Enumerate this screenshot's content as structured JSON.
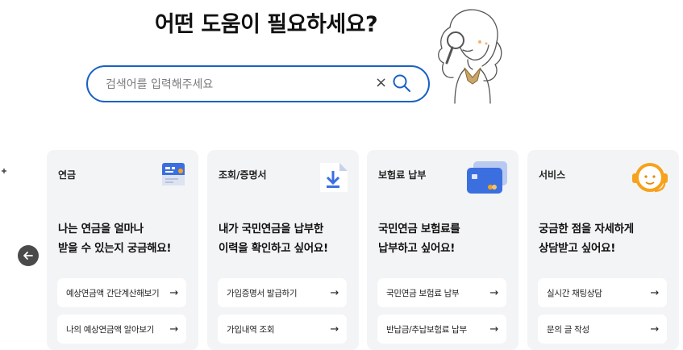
{
  "header": {
    "title": "어떤 도움이 필요하세요?"
  },
  "search": {
    "placeholder": "검색어를 입력해주세요",
    "clear_icon": "×"
  },
  "carousel": {
    "prev_icon": "arrow-left-icon"
  },
  "cards": [
    {
      "category": "연금",
      "icon": "pension-calculator-icon",
      "headline_line1": "나는 연금을 얼마나",
      "headline_line2": "받을 수 있는지 궁금해요!",
      "links": [
        {
          "label": "예상연금액 간단계산해보기"
        },
        {
          "label": "나의 예상연금액 알아보기"
        }
      ]
    },
    {
      "category": "조회/증명서",
      "icon": "document-download-icon",
      "headline_line1": "내가 국민연금을 납부한",
      "headline_line2": "이력을 확인하고 싶어요!",
      "links": [
        {
          "label": "가입증명서 발급하기"
        },
        {
          "label": "가입내역 조회"
        }
      ]
    },
    {
      "category": "보험료 납부",
      "icon": "credit-card-icon",
      "headline_line1": "국민연금 보험료를",
      "headline_line2": "납부하고 싶어요!",
      "links": [
        {
          "label": "국민연금 보험료 납부"
        },
        {
          "label": "반납금/추납보험료 납부"
        }
      ]
    },
    {
      "category": "서비스",
      "icon": "headset-icon",
      "headline_line1": "궁금한 점을 자세하게",
      "headline_line2": "상담받고 싶어요!",
      "links": [
        {
          "label": "실시간 채팅상담"
        },
        {
          "label": "문의 글 작성"
        }
      ]
    }
  ],
  "link_arrow": "→",
  "colors": {
    "accent": "#1a61c4",
    "card_bg": "#f3f4f6",
    "orange": "#f7a21b",
    "blue_icon": "#3b6fe0"
  }
}
